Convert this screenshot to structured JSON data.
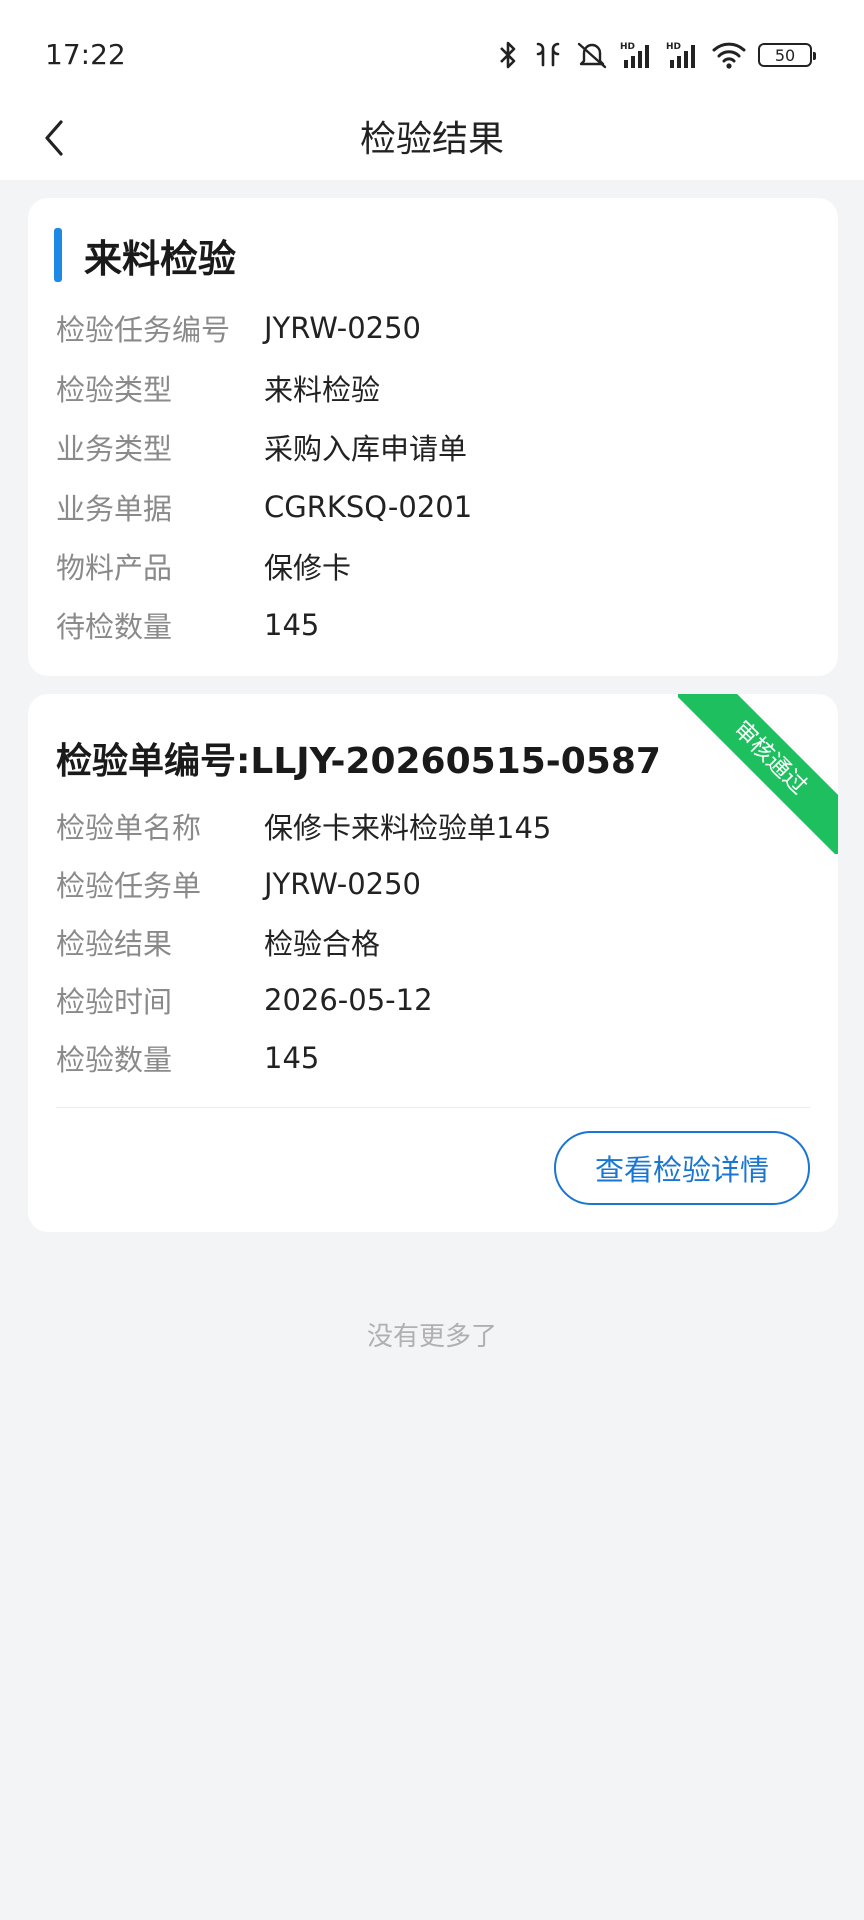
{
  "status_bar": {
    "time": "17:22",
    "battery": "50",
    "icons": [
      "bluetooth-icon",
      "earbuds-icon",
      "mute-icon",
      "hd-signal-icon",
      "hd-signal-icon",
      "wifi-icon",
      "battery-icon"
    ]
  },
  "nav": {
    "title": "检验结果",
    "back_icon": "chevron-left-icon"
  },
  "task_card": {
    "title": "来料检验",
    "accent_color": "#1e88e5",
    "fields": [
      {
        "label": "检验任务编号",
        "value": "JYRW-0250"
      },
      {
        "label": "检验类型",
        "value": "来料检验"
      },
      {
        "label": "业务类型",
        "value": "采购入库申请单"
      },
      {
        "label": "业务单据",
        "value": "CGRKSQ-0201"
      },
      {
        "label": "物料产品",
        "value": "保修卡"
      },
      {
        "label": "待检数量",
        "value": "145"
      }
    ]
  },
  "inspection_card": {
    "header_label": "检验单编号:",
    "header_value": "LLJY-20260515-0587",
    "badge": "审核通过",
    "badge_color": "#1dbf5e",
    "fields": [
      {
        "label": "检验单名称",
        "value": "保修卡来料检验单145"
      },
      {
        "label": "检验任务单",
        "value": "JYRW-0250"
      },
      {
        "label": "检验结果",
        "value": "检验合格"
      },
      {
        "label": "检验时间",
        "value": "2026-05-12"
      },
      {
        "label": "检验数量",
        "value": "145"
      }
    ],
    "button_label": "查看检验详情",
    "button_color": "#1976d2"
  },
  "footer": {
    "no_more": "没有更多了"
  }
}
